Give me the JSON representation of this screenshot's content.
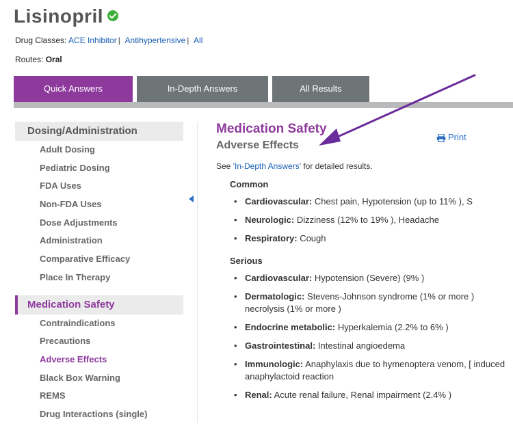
{
  "drug": {
    "name": "Lisinopril"
  },
  "classes": {
    "label": "Drug Classes:",
    "items": [
      "ACE Inhibitor",
      "Antihypertensive",
      "All"
    ],
    "separators": [
      "|",
      "|"
    ]
  },
  "routes": {
    "label": "Routes:",
    "value": "Oral"
  },
  "tabs": [
    "Quick Answers",
    "In-Depth Answers",
    "All Results"
  ],
  "nav": {
    "section1": {
      "title": "Dosing/Administration",
      "items": [
        "Adult Dosing",
        "Pediatric Dosing",
        "FDA Uses",
        "Non-FDA Uses",
        "Dose Adjustments",
        "Administration",
        "Comparative Efficacy",
        "Place In Therapy"
      ]
    },
    "section2": {
      "title": "Medication Safety",
      "items": [
        "Contraindications",
        "Precautions",
        "Adverse Effects",
        "Black Box Warning",
        "REMS",
        "Drug Interactions (single)"
      ]
    }
  },
  "main": {
    "title": "Medication Safety",
    "subtitle": "Adverse Effects",
    "print": "Print",
    "see": {
      "prefix": "See ",
      "link": "'In-Depth Answers'",
      "suffix": " for detailed results."
    },
    "common": {
      "heading": "Common",
      "items": [
        {
          "label": "Cardiovascular:",
          "text": " Chest pain, Hypotension (up to 11% ), S"
        },
        {
          "label": "Neurologic:",
          "text": " Dizziness (12% to 19% ), Headache"
        },
        {
          "label": "Respiratory:",
          "text": " Cough"
        }
      ]
    },
    "serious": {
      "heading": "Serious",
      "items": [
        {
          "label": "Cardiovascular:",
          "text": " Hypotension (Severe) (9% )"
        },
        {
          "label": "Dermatologic:",
          "text": " Stevens-Johnson syndrome (1% or more ) necrolysis (1% or more )"
        },
        {
          "label": "Endocrine metabolic:",
          "text": " Hyperkalemia (2.2% to 6% )"
        },
        {
          "label": "Gastrointestinal:",
          "text": " Intestinal angioedema"
        },
        {
          "label": "Immunologic:",
          "text": " Anaphylaxis due to hymenoptera venom, [ induced anaphylactoid reaction"
        },
        {
          "label": "Renal:",
          "text": " Acute renal failure, Renal impairment (2.4% )"
        }
      ]
    }
  },
  "colors": {
    "accent": "#8e3a9d",
    "link": "#1a5fb4",
    "tab_grey": "#6e7576",
    "arrow": "#6a2c9a"
  }
}
